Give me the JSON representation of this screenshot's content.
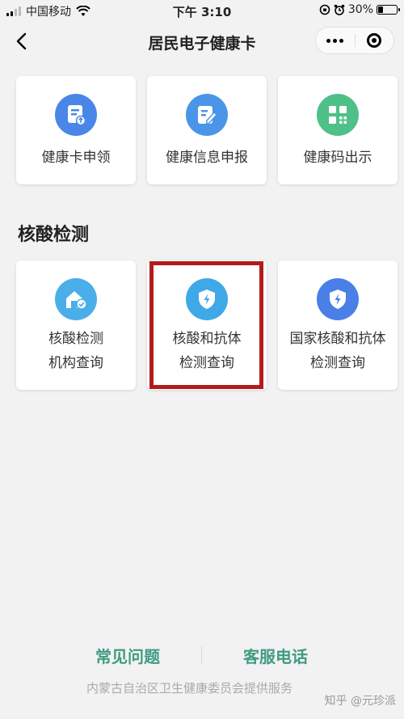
{
  "status": {
    "carrier": "中国移动",
    "time": "下午 3:10",
    "battery": "30%",
    "battery_level": 0.3
  },
  "nav": {
    "title": "居民电子健康卡",
    "back_icon": "back-arrow-icon",
    "more_icon": "more-dots-icon",
    "close_icon": "mini-program-close-icon"
  },
  "top_actions": [
    {
      "label": "健康卡申领",
      "icon": "health-card-apply-icon",
      "color": "#4a86e8"
    },
    {
      "label": "健康信息申报",
      "icon": "edit-report-icon",
      "color": "#4a95e8"
    },
    {
      "label": "健康码出示",
      "icon": "qr-code-icon",
      "color": "#4fc087"
    }
  ],
  "section": {
    "title": "核酸检测"
  },
  "test_actions": [
    {
      "line1": "核酸检测",
      "line2": "机构查询",
      "icon": "house-check-icon",
      "color": "#4aaee8"
    },
    {
      "line1": "核酸和抗体",
      "line2": "检测查询",
      "icon": "shield-bolt-icon",
      "color": "#3fa9e8"
    },
    {
      "line1": "国家核酸和抗体",
      "line2": "检测查询",
      "icon": "shield-bolt-icon",
      "color": "#4a7fe8"
    }
  ],
  "footer": {
    "faq": "常见问题",
    "service": "客服电话",
    "note": "内蒙古自治区卫生健康委员会提供服务",
    "watermark": "知乎 @元珍派"
  }
}
